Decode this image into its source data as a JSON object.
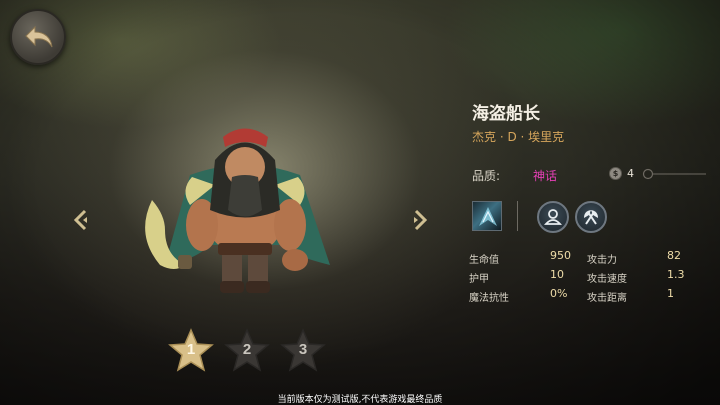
{
  "hero": {
    "name": "海盗船长",
    "subtitle": "杰克 · D · 埃里克"
  },
  "quality": {
    "label": "品质:",
    "value": "神话",
    "color": "#e63fb6"
  },
  "level": {
    "icon": "coin-level-icon",
    "value": "4"
  },
  "roles": [
    {
      "icon": "portrait-role-icon"
    },
    {
      "icon": "axe-role-icon"
    }
  ],
  "ability": {
    "icon": "ability-skill-icon"
  },
  "stats": {
    "hp_label": "生命值",
    "hp_value": "950",
    "attack_label": "攻击力",
    "attack_value": "82",
    "armor_label": "护甲",
    "armor_value": "10",
    "attack_speed_label": "攻击速度",
    "attack_speed_value": "1.3",
    "magic_resist_label": "魔法抗性",
    "magic_resist_value": "0%",
    "attack_range_label": "攻击距离",
    "attack_range_value": "1"
  },
  "stars": [
    {
      "label": "1",
      "state": "active"
    },
    {
      "label": "2",
      "state": "inactive"
    },
    {
      "label": "3",
      "state": "inactive"
    }
  ],
  "navigation": {
    "back_icon": "back-arrow-icon",
    "prev_icon": "chevron-left-icon",
    "next_icon": "chevron-right-icon"
  },
  "disclaimer": "当前版本仅为测试版,不代表游戏最终品质",
  "colors": {
    "accent_gold": "#d6a65c",
    "mythic_pink": "#e63fb6",
    "stat_value": "#eedca8"
  }
}
